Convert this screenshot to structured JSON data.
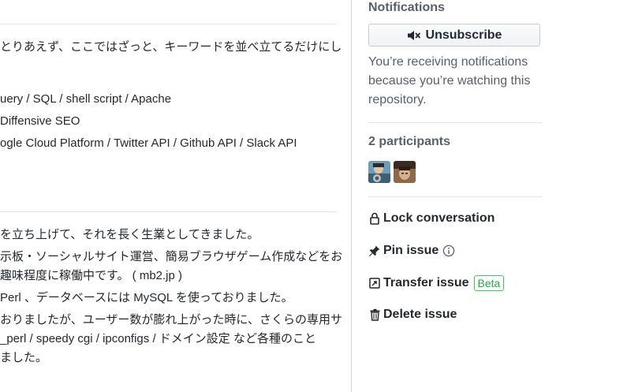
{
  "content": {
    "lines_a": [
      "とりあえず、ここではざっと、キーワードを並べ立てるだけにし",
      "uery / SQL / shell script / Apache",
      "Diffensive SEO",
      "ogle Cloud Platform / Twitter API / Github API / Slack API"
    ],
    "lines_b": [
      "を立ち上げて、それを長く生業としてきました。",
      "示板・ソーシャルサイト運営、簡易ブラウザゲーム作成などをお",
      "趣味程度に稼働中です。 ( mb2.jp )",
      " Perl 、データベースには MySQL を使っておりました。",
      "おりましたが、ユーザー数が膨れ上がった時に、さくらの専用サ",
      "_perl / speedy cgi / ipconfigs / ドメイン設定 など各種のこと",
      "ました。"
    ]
  },
  "sidebar": {
    "notifications": {
      "heading": "Notifications",
      "button_label": "Unsubscribe",
      "button_icon": "mute-icon",
      "note": "You’re receiving notifications because you’re watching this repository."
    },
    "participants": {
      "heading": "2 participants"
    },
    "actions": {
      "lock": "Lock conversation",
      "pin": "Pin issue",
      "transfer": "Transfer issue",
      "transfer_badge": "Beta",
      "delete": "Delete issue"
    },
    "colors": {
      "badge_green": "#28a745",
      "muted_text": "#586069"
    }
  }
}
